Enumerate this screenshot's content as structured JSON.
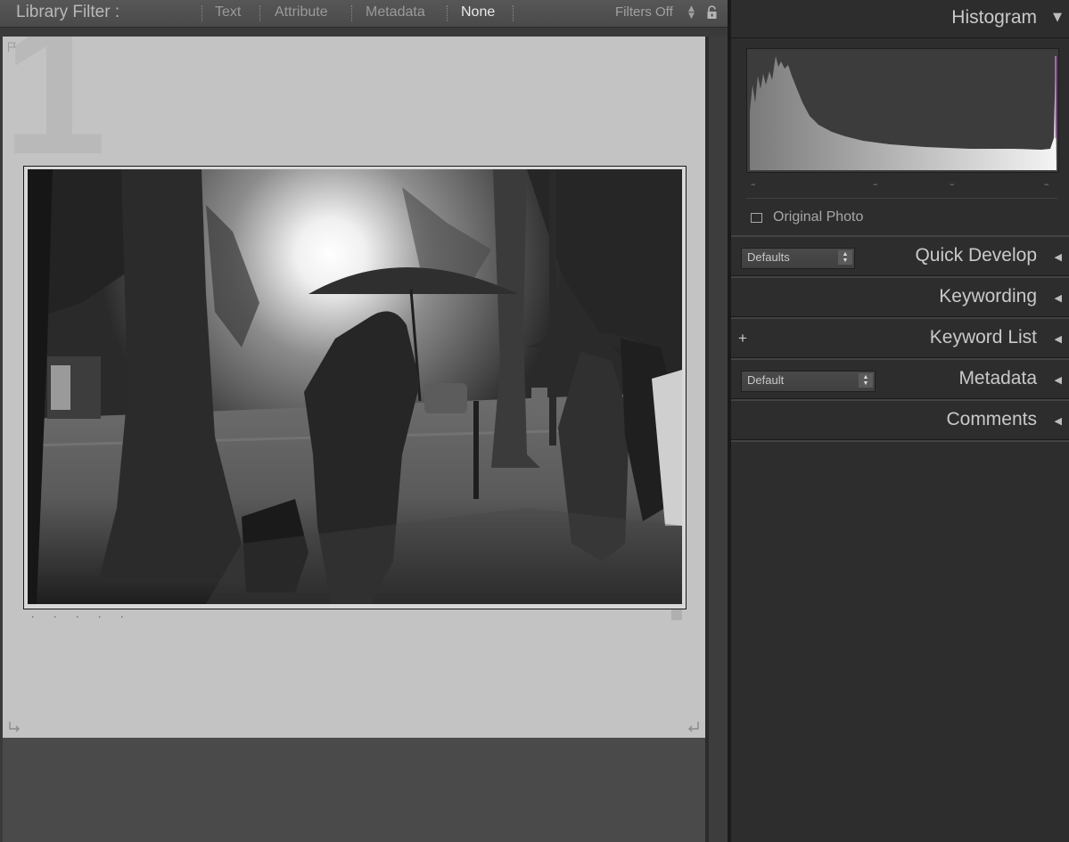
{
  "filter_bar": {
    "title": "Library Filter :",
    "tabs": [
      {
        "label": "Text",
        "active": false
      },
      {
        "label": "Attribute",
        "active": false
      },
      {
        "label": "Metadata",
        "active": false
      },
      {
        "label": "None",
        "active": true
      }
    ],
    "filters_status": "Filters Off",
    "icons": {
      "updown": "up-down-arrows-icon",
      "lock": "lock-icon"
    }
  },
  "loupe": {
    "background_color": "#c3c3c3",
    "frame_number": "1",
    "rating_dots": "· · · · ·",
    "icons": [
      "flag-icon",
      "rotate-left-icon",
      "rotate-right-icon"
    ],
    "photo": {
      "description_kind": "black-and-white street photo"
    }
  },
  "right_panel": {
    "histogram": {
      "title": "Histogram",
      "tick_marks": [
        "–",
        "–",
        "–",
        "–"
      ],
      "original_photo_label": "Original Photo",
      "original_photo_checked": false
    },
    "quick_develop": {
      "title": "Quick Develop",
      "preset": "Defaults"
    },
    "keywording": {
      "title": "Keywording"
    },
    "keyword_list": {
      "title": "Keyword List",
      "add_symbol": "+"
    },
    "metadata": {
      "title": "Metadata",
      "preset": "Default"
    },
    "comments": {
      "title": "Comments"
    },
    "triangle_expanded": "▼",
    "triangle_collapsed": "◀"
  }
}
